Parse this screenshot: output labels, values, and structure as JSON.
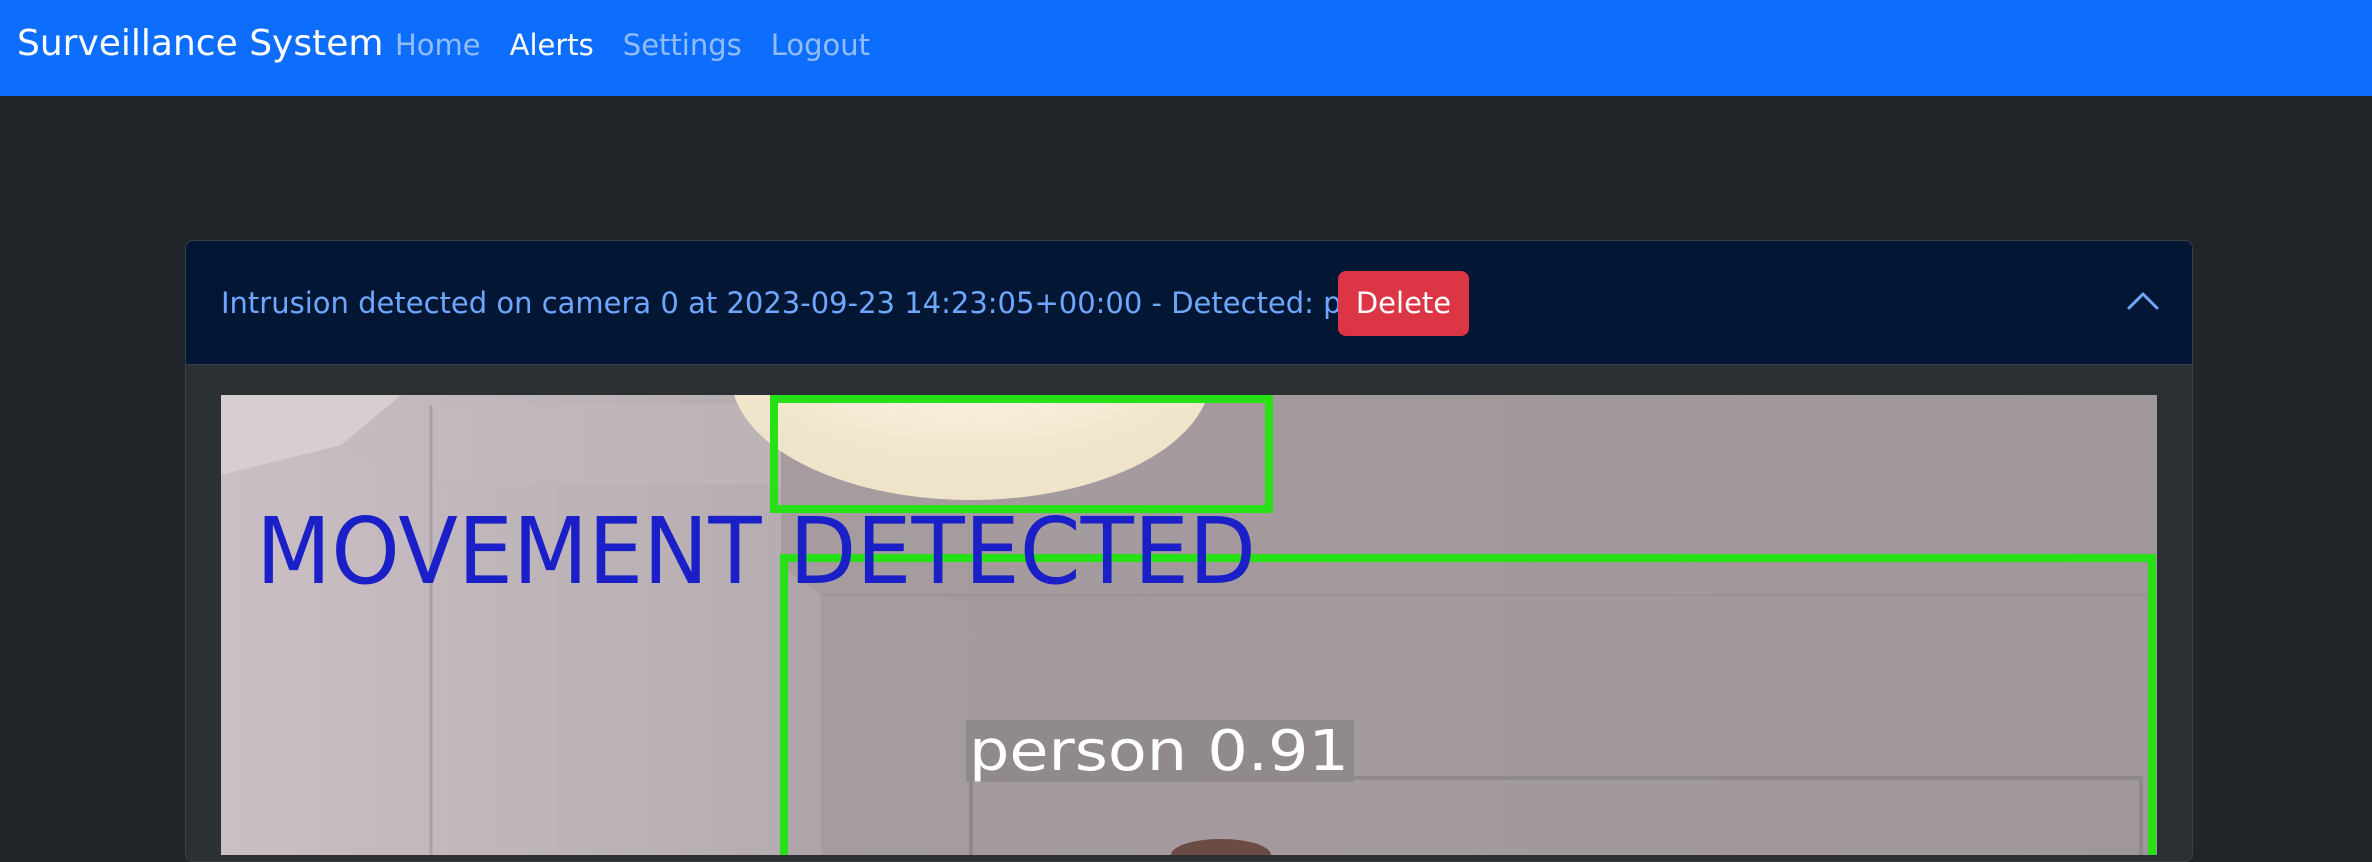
{
  "navbar": {
    "brand": "Surveillance System",
    "links": [
      {
        "label": "Home",
        "active": false
      },
      {
        "label": "Alerts",
        "active": true
      },
      {
        "label": "Settings",
        "active": false
      },
      {
        "label": "Logout",
        "active": false
      }
    ]
  },
  "alert": {
    "message": "Intrusion detected on camera 0 at 2023-09-23 14:23:05+00:00 - Detected: person",
    "delete_label": "Delete",
    "expanded": true,
    "icon": "chevron-up-icon",
    "snapshot": {
      "overlay_text": "MOVEMENT DETECTED",
      "detection_label": "person 0.91",
      "box_color": "#28e016",
      "overlay_color": "#1a1fc8"
    }
  },
  "colors": {
    "navbar": "#0d6efd",
    "background": "#212529",
    "header": "#031633",
    "alert_text": "#6ea8fe",
    "danger": "#dc3545"
  }
}
